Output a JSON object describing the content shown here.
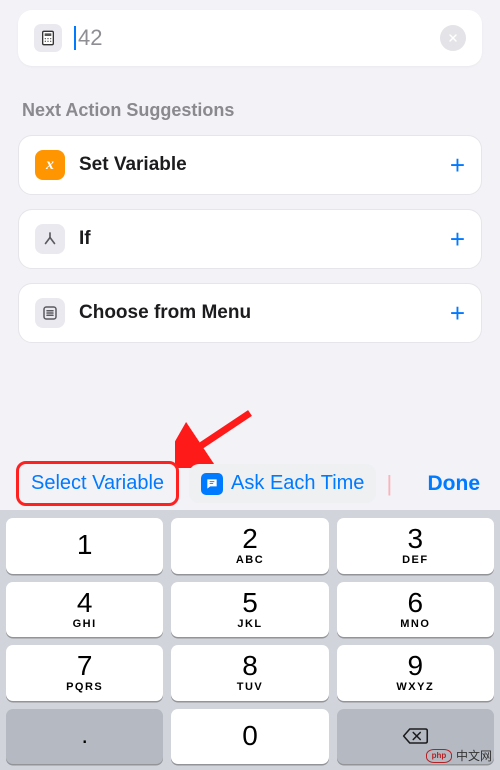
{
  "number_action": {
    "value": "42",
    "icon": "calculator-icon"
  },
  "section_heading": "Next Action Suggestions",
  "suggestions": [
    {
      "label": "Set Variable",
      "icon": "variable-x-icon",
      "icon_color": "#ff9500"
    },
    {
      "label": "If",
      "icon": "branch-icon",
      "icon_color": "#e9e9ef"
    },
    {
      "label": "Choose from Menu",
      "icon": "menu-list-icon",
      "icon_color": "#e9e9ef"
    }
  ],
  "toolbar": {
    "select_variable": "Select Variable",
    "ask_each_time": "Ask Each Time",
    "done": "Done"
  },
  "keyboard": {
    "keys": [
      {
        "digit": "1",
        "sub": ""
      },
      {
        "digit": "2",
        "sub": "ABC"
      },
      {
        "digit": "3",
        "sub": "DEF"
      },
      {
        "digit": "4",
        "sub": "GHI"
      },
      {
        "digit": "5",
        "sub": "JKL"
      },
      {
        "digit": "6",
        "sub": "MNO"
      },
      {
        "digit": "7",
        "sub": "PQRS"
      },
      {
        "digit": "8",
        "sub": "TUV"
      },
      {
        "digit": "9",
        "sub": "WXYZ"
      },
      {
        "digit": ".",
        "sub": ""
      },
      {
        "digit": "0",
        "sub": ""
      }
    ]
  },
  "annotation": {
    "highlighted_button": "select_variable",
    "arrow_points_to": "select_variable"
  },
  "watermark": {
    "text": "中文网",
    "logo": "php"
  }
}
